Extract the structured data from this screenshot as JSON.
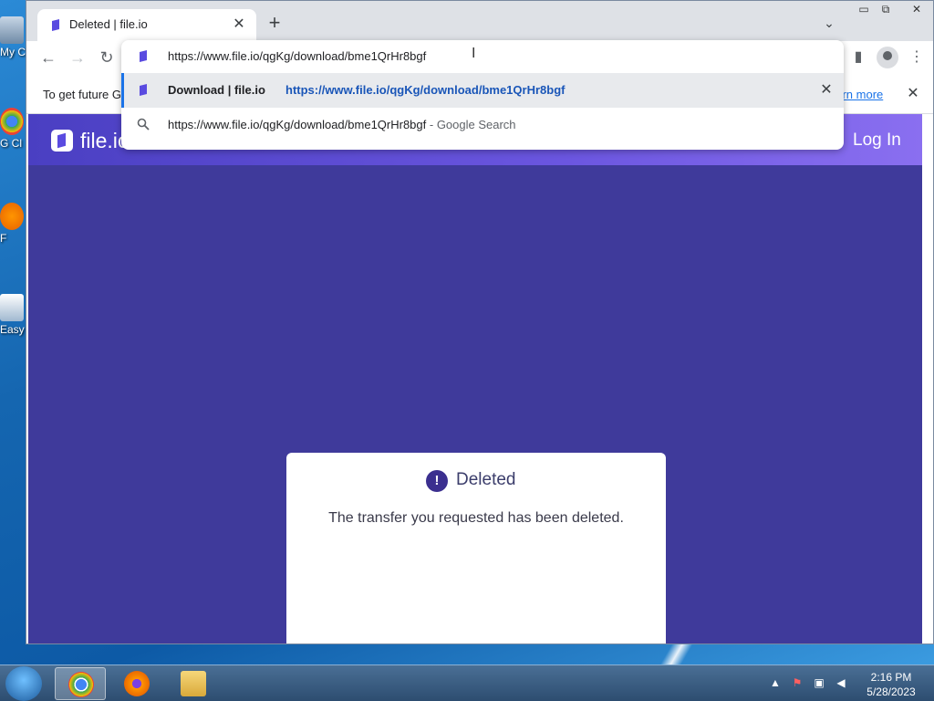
{
  "desktop": {
    "icons": [
      {
        "label": "My C",
        "icon": "computer-icon"
      },
      {
        "label": "G Cl",
        "icon": "chrome-icon"
      },
      {
        "label": "F",
        "icon": "firefox-icon"
      },
      {
        "label": "Easy",
        "icon": "app-icon"
      }
    ]
  },
  "browser": {
    "tab": {
      "title": "Deleted | file.io",
      "favicon": "fileio-favicon-icon"
    },
    "omnibox": {
      "url": "https://www.file.io/qgKg/download/bme1QrHr8bgf",
      "suggestions": [
        {
          "title": "Download | file.io",
          "url": "https://www.file.io/qgKg/download/bme1QrHr8bgf"
        },
        {
          "query": "https://www.file.io/qgKg/download/bme1QrHr8bgf",
          "suffix": " - Google Search"
        }
      ]
    },
    "infobar": {
      "message": "To get future G",
      "learn_more": "earn more"
    }
  },
  "page": {
    "logo_text": "file.io",
    "login_label": "Log In",
    "card": {
      "heading": "Deleted",
      "alert_glyph": "!",
      "message": "The transfer you requested has been deleted."
    },
    "colors": {
      "background": "#3f3a9b",
      "header_start": "#4a3fc2",
      "header_end": "#8a6ff0",
      "accent": "#3b2f8f"
    }
  },
  "taskbar": {
    "apps": [
      "chrome-icon",
      "firefox-icon",
      "file-explorer-icon"
    ],
    "time": "2:16 PM",
    "date": "5/28/2023"
  }
}
